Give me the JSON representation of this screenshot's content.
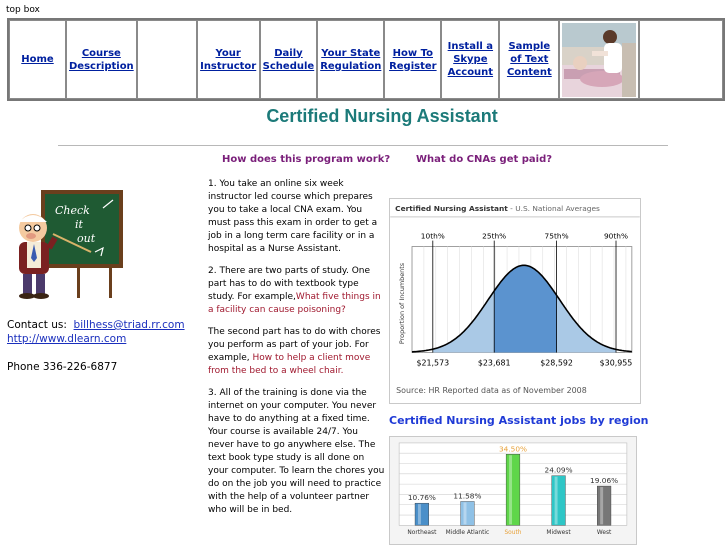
{
  "topbox_label": "top box",
  "nav": {
    "home": "Home",
    "course_description": "Course Description",
    "your_instructor": "Your Instructor",
    "daily_schedule": "Daily Schedule",
    "your_state_regulation": "Your State Regulation",
    "how_to_register": "How To Register",
    "install_skype": "Install a Skype Account",
    "sample_text": "Sample of Text Content"
  },
  "page_title": "Certified Nursing Assistant",
  "question_left": "How does this program work?",
  "question_right": "What do CNAs get paid?",
  "teacher_board": {
    "line1": "Check",
    "line2": "it",
    "line3": "out"
  },
  "contact": {
    "label": "Contact us:",
    "email": "billhess@triad.rr.com",
    "website": "http://www.dlearn.com",
    "phone": "Phone 336-226-6877"
  },
  "program_text": {
    "p1": "1. You take an online six week instructor led course which prepares you to take a local CNA exam.  You must pass this exam in order to get a job in a long term care facility or in a hospital as a Nurse Assistant.",
    "p2a": "2. There are two parts of study.  One part has to do with textbook type study. For example,",
    "p2b": "What five things in a facility can cause poisoning?",
    "p3a": "The second part has to do with chores you perform as part of your job. For example, ",
    "p3b": "How to help a client move from the bed to a wheel chair.",
    "p4": "3. All of the training is done via the internet on your computer.  You never have to do anything at a fixed time. Your course is available 24/7. You never have to go anywhere else.  The text book type study is all done on your computer.  To learn the chores you do on the job you will need to  practice with the help of a volunteer partner who will be in bed."
  },
  "salary_chart": {
    "title_bold": "Certified Nursing Assistant",
    "title_rest": " - U.S. National Averages",
    "y_axis_label": "Proportion of Incumbents",
    "percentiles": [
      "10th%",
      "25th%",
      "75th%",
      "90th%"
    ],
    "values": [
      "$21,573",
      "$23,681",
      "$28,592",
      "$30,955"
    ],
    "source": "Source: HR Reported data as of November  2008",
    "colors": {
      "outer": "#aac9e6",
      "inner": "#5b93cf",
      "curve": "#000000"
    }
  },
  "jobs_region_title": "Certified Nursing Assistant jobs by region",
  "chart_data": {
    "type": "bar",
    "title": "Certified Nursing Assistant jobs by region",
    "categories": [
      "Northeast",
      "Middle Atlantic",
      "South",
      "Midwest",
      "West"
    ],
    "values": [
      10.76,
      11.58,
      34.5,
      24.09,
      19.06
    ],
    "value_labels": [
      "10.76%",
      "11.58%",
      "34.50%",
      "24.09%",
      "19.06%"
    ],
    "bar_colors": [
      "#4a8fc9",
      "#8fc1e6",
      "#5fd64a",
      "#2ec6c6",
      "#777777"
    ],
    "highlight_color": "#e8a23a",
    "ylim": [
      0,
      40
    ],
    "grid": true
  }
}
